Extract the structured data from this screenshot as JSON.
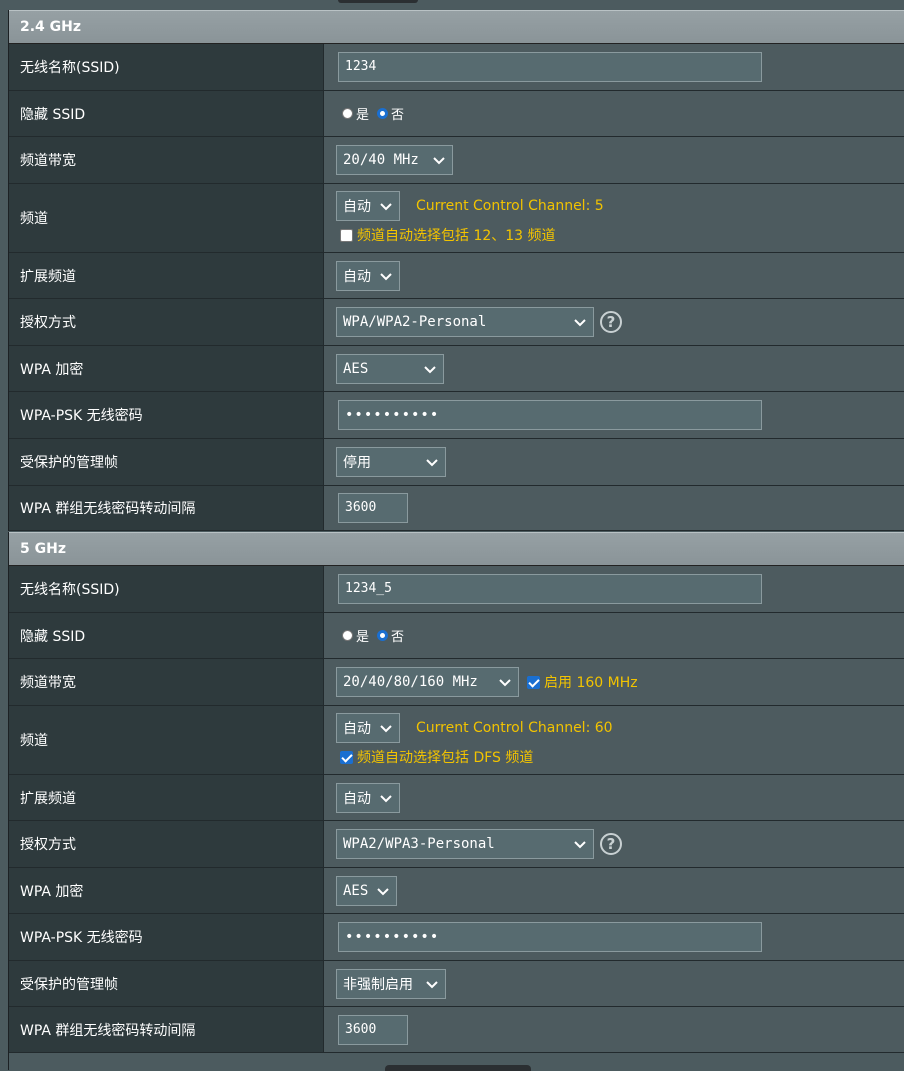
{
  "band24": {
    "header": "2.4 GHz",
    "ssid_label": "无线名称(SSID)",
    "ssid_value": "1234",
    "hide_label": "隐藏 SSID",
    "hide_yes": "是",
    "hide_no": "否",
    "bw_label": "频道带宽",
    "bw_value": "20/40 MHz",
    "ch_label": "频道",
    "ch_value": "自动",
    "ch_current": "Current Control Channel: 5",
    "ch_auto_note": "频道自动选择包括 12、13 频道",
    "ext_label": "扩展频道",
    "ext_value": "自动",
    "auth_label": "授权方式",
    "auth_value": "WPA/WPA2-Personal",
    "enc_label": "WPA 加密",
    "enc_value": "AES",
    "psk_label": "WPA-PSK 无线密码",
    "psk_value": "••••••••••",
    "pmf_label": "受保护的管理帧",
    "pmf_value": "停用",
    "rekey_label": "WPA 群组无线密码转动间隔",
    "rekey_value": "3600"
  },
  "band5": {
    "header": "5 GHz",
    "ssid_label": "无线名称(SSID)",
    "ssid_value": "1234_5",
    "hide_label": "隐藏 SSID",
    "hide_yes": "是",
    "hide_no": "否",
    "bw_label": "频道带宽",
    "bw_value": "20/40/80/160 MHz",
    "bw160_label": "启用 160 MHz",
    "ch_label": "频道",
    "ch_value": "自动",
    "ch_current": "Current Control Channel: 60",
    "ch_auto_note": "频道自动选择包括 DFS 频道",
    "ext_label": "扩展频道",
    "ext_value": "自动",
    "auth_label": "授权方式",
    "auth_value": "WPA2/WPA3-Personal",
    "enc_label": "WPA 加密",
    "enc_value": "AES",
    "psk_label": "WPA-PSK 无线密码",
    "psk_value": "••••••••••",
    "pmf_label": "受保护的管理帧",
    "pmf_value": "非强制启用",
    "rekey_label": "WPA 群组无线密码转动间隔",
    "rekey_value": "3600"
  },
  "icons": {
    "chevron": "chevron-down-icon",
    "help": "question-mark-icon",
    "help_glyph": "?"
  },
  "colors": {
    "accent_yellow": "#f2c300",
    "radio_blue": "#1a6fd1"
  }
}
